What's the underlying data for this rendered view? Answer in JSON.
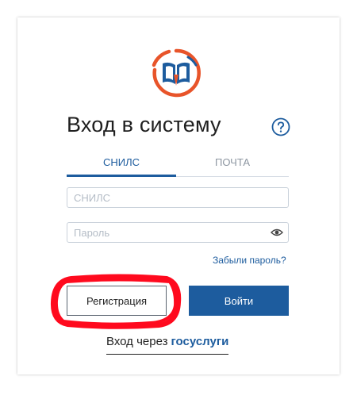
{
  "header": {
    "title": "Вход в систему",
    "help_icon": "question-circle-icon",
    "logo_icon": "open-book-logo-icon"
  },
  "tabs": [
    {
      "label": "СНИЛС",
      "active": true
    },
    {
      "label": "ПОЧТА",
      "active": false
    }
  ],
  "form": {
    "snils_placeholder": "СНИЛС",
    "password_placeholder": "Пароль",
    "password_toggle_icon": "eye-icon",
    "forgot_label": "Забыли пароль?"
  },
  "actions": {
    "register_label": "Регистрация",
    "login_label": "Войти"
  },
  "gosuslugi": {
    "prefix": "Вход через",
    "brand": "госуслуги"
  },
  "colors": {
    "accent": "#1d5c9e",
    "logo_orange": "#e8542a",
    "highlight_red": "#ff0a1e"
  }
}
